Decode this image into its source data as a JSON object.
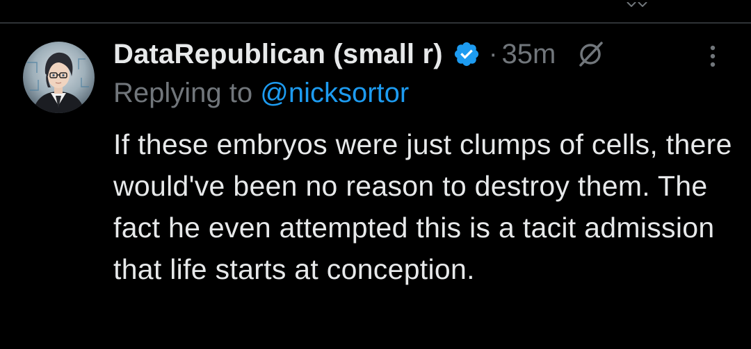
{
  "tweet": {
    "display_name": "DataRepublican (small r)",
    "separator": "·",
    "timestamp": "35m",
    "replying_prefix": "Replying to",
    "replying_to_handle": "@nicksortor",
    "body": "If these embryos were just clumps of cells, there would've been no reason to destroy them. The fact he even attempted this is a tacit admission that life starts at conception."
  },
  "icons": {
    "verified": "verified-badge-icon",
    "grok": "grok-icon",
    "more": "more-vertical-icon",
    "avatar": "avatar"
  },
  "colors": {
    "background": "#000000",
    "text_primary": "#e7e9ea",
    "text_secondary": "#71767b",
    "link": "#1d9bf0",
    "verified": "#1d9bf0",
    "divider": "#2f3336"
  }
}
